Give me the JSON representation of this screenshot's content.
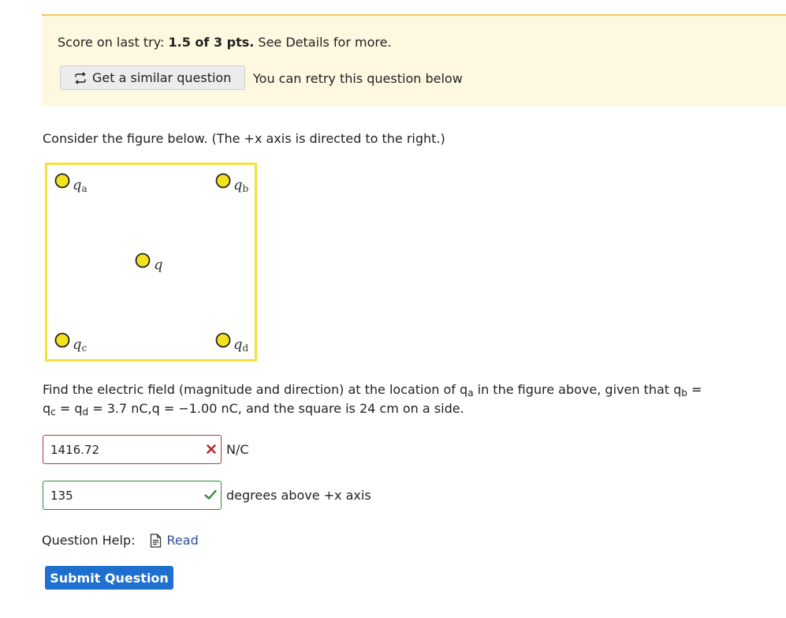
{
  "score": {
    "prefix": "Score on last try: ",
    "value": "1.5 of 3 pts.",
    "suffix": " See Details for more."
  },
  "similar_button": {
    "label": "Get a similar question",
    "icon": "retry-icon"
  },
  "retry_text": "You can retry this question below",
  "intro": "Consider the figure below. (The +x axis is directed to the right.)",
  "figure": {
    "labels": {
      "qa_main": "q",
      "qa_sub": "a",
      "qb_main": "q",
      "qb_sub": "b",
      "qc_main": "q",
      "qc_sub": "c",
      "qd_main": "q",
      "qd_sub": "d",
      "q": "q"
    },
    "colors": {
      "border": "#f2e23a",
      "charge_fill": "#f4e21e",
      "charge_stroke": "#222222"
    }
  },
  "problem": {
    "t1": "Find the electric field (magnitude and direction) at the location of q",
    "s1": "a",
    "t2": " in the figure above, given that q",
    "s2": "b",
    "t3": " =",
    "t4": "q",
    "s4": "c",
    "t5": " = q",
    "s5": "d",
    "t6": " = 3.7 nC,q = −1.00 nC, and the square is 24 cm on a side."
  },
  "answers": [
    {
      "value": "1416.72",
      "unit": "N/C",
      "status": "incorrect",
      "status_color": "#b32d2d"
    },
    {
      "value": "135",
      "unit": "degrees above +x axis",
      "status": "correct",
      "status_color": "#2c8a3b"
    }
  ],
  "help": {
    "label": "Question Help:",
    "read_label": "Read",
    "read_icon": "document-icon"
  },
  "submit_label": "Submit Question",
  "colors": {
    "panel_bg": "#fdf8df",
    "panel_border": "#f0c75c",
    "submit_bg": "#1f6fcf",
    "link": "#2c4f9a"
  }
}
